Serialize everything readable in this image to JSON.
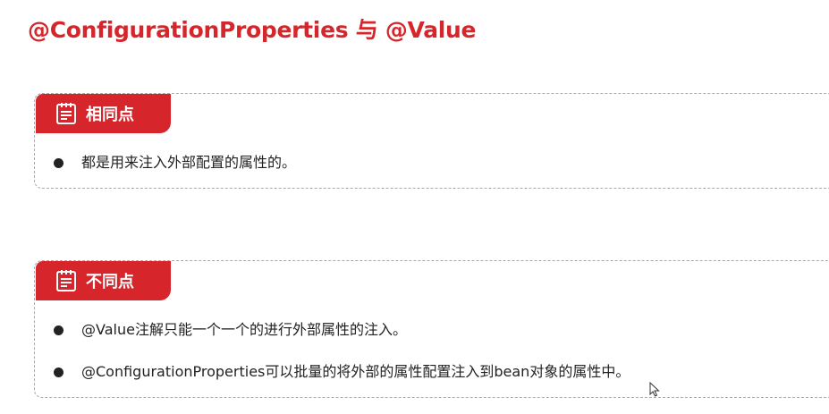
{
  "slide": {
    "title": "@ConfigurationProperties 与 @Value"
  },
  "sections": [
    {
      "label": "相同点",
      "icon": "notepad-icon",
      "items": [
        "都是用来注入外部配置的属性的。"
      ]
    },
    {
      "label": "不同点",
      "icon": "notepad-icon",
      "items": [
        "@Value注解只能一个一个的进行外部属性的注入。",
        "@ConfigurationProperties可以批量的将外部的属性配置注入到bean对象的属性中。"
      ]
    }
  ],
  "colors": {
    "accent": "#d6262b",
    "text": "#222222",
    "border": "#a9a9a9"
  }
}
